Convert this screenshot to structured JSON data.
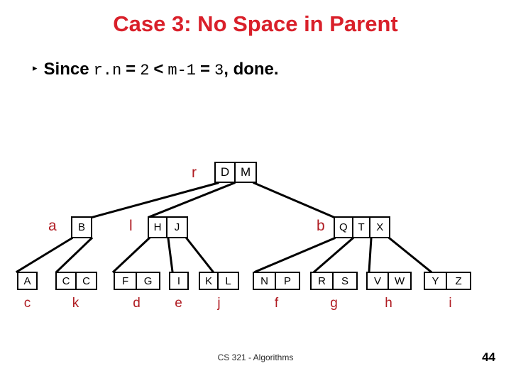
{
  "slide": {
    "title": "Case 3: No Space in Parent",
    "title_color": "#d9202a",
    "bullet": {
      "marker": "▸",
      "part1_text": "Since",
      "part2_code": "r.n",
      "part3_text": "=",
      "part4_code": "2",
      "part5_text": "<",
      "part6_code": "m-1",
      "part7_text": "=",
      "part8_code": "3",
      "part9_text": ", done."
    },
    "footer": {
      "course": "CS 321 - Algorithms",
      "page_number": "44"
    }
  },
  "tree": {
    "label_color": "#b01c22",
    "root": {
      "label": "r",
      "keys": [
        "D",
        "M"
      ]
    },
    "internal": [
      {
        "label": "a",
        "keys": [
          "B"
        ]
      },
      {
        "label": "l",
        "keys": [
          "H",
          "J"
        ]
      },
      {
        "label": "b",
        "keys": [
          "Q",
          "T",
          "X"
        ]
      }
    ],
    "leaves": [
      {
        "label": "c",
        "keys": [
          "A"
        ]
      },
      {
        "label": "k",
        "keys": [
          "C",
          "C"
        ]
      },
      {
        "label": "d",
        "keys": [
          "F",
          "G"
        ]
      },
      {
        "label": "e",
        "keys": [
          "I"
        ]
      },
      {
        "label": "j",
        "keys": [
          "K",
          "L"
        ]
      },
      {
        "label": "f",
        "keys": [
          "N",
          "P"
        ]
      },
      {
        "label": "g",
        "keys": [
          "R",
          "S"
        ]
      },
      {
        "label": "h",
        "keys": [
          "V",
          "W"
        ]
      },
      {
        "label": "i",
        "keys": [
          "Y",
          "Z"
        ]
      }
    ]
  }
}
